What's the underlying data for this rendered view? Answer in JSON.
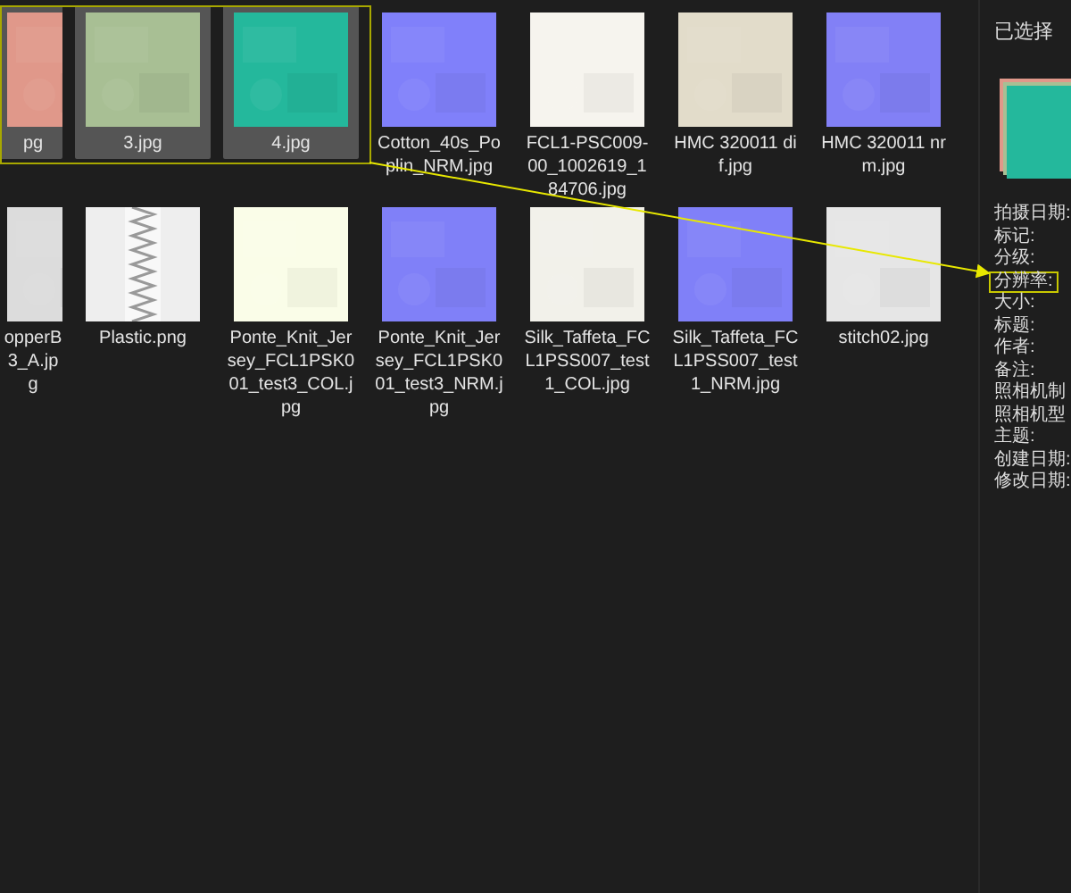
{
  "files": [
    {
      "label": "pg",
      "selected": true
    },
    {
      "label": "3.jpg",
      "selected": true
    },
    {
      "label": "4.jpg",
      "selected": true
    },
    {
      "label": "Cotton_40s_Poplin_NRM.jpg",
      "selected": false
    },
    {
      "label": "FCL1-PSC009-00_1002619_184706.jpg",
      "selected": false
    },
    {
      "label": "HMC 320011 dif.jpg",
      "selected": false
    },
    {
      "label": "HMC 320011 nrm.jpg",
      "selected": false
    },
    {
      "label": "opperB 3_A.jpg",
      "selected": false
    },
    {
      "label": "Plastic.png",
      "selected": false
    },
    {
      "label": "Ponte_Knit_Jersey_FCL1PSK001_test3_COL.jpg",
      "selected": false
    },
    {
      "label": "Ponte_Knit_Jersey_FCL1PSK001_test3_NRM.jpg",
      "selected": false
    },
    {
      "label": "Silk_Taffeta_FCL1PSS007_test1_COL.jpg",
      "selected": false
    },
    {
      "label": "Silk_Taffeta_FCL1PSS007_test1_NRM.jpg",
      "selected": false
    },
    {
      "label": "stitch02.jpg",
      "selected": false
    }
  ],
  "details": {
    "title": "已选择",
    "properties": [
      {
        "label": "拍摄日期:",
        "highlighted": false
      },
      {
        "label": "标记:",
        "highlighted": false
      },
      {
        "label": "分级:",
        "highlighted": false
      },
      {
        "label": "分辨率:",
        "highlighted": true
      },
      {
        "label": "大小:",
        "highlighted": false
      },
      {
        "label": "标题:",
        "highlighted": false
      },
      {
        "label": "作者:",
        "highlighted": false
      },
      {
        "label": "备注:",
        "highlighted": false
      },
      {
        "label": "照相机制",
        "highlighted": false
      },
      {
        "label": "照相机型",
        "highlighted": false
      },
      {
        "label": "主题:",
        "highlighted": false
      },
      {
        "label": "创建日期:",
        "highlighted": false
      },
      {
        "label": "修改日期:",
        "highlighted": false
      }
    ]
  }
}
